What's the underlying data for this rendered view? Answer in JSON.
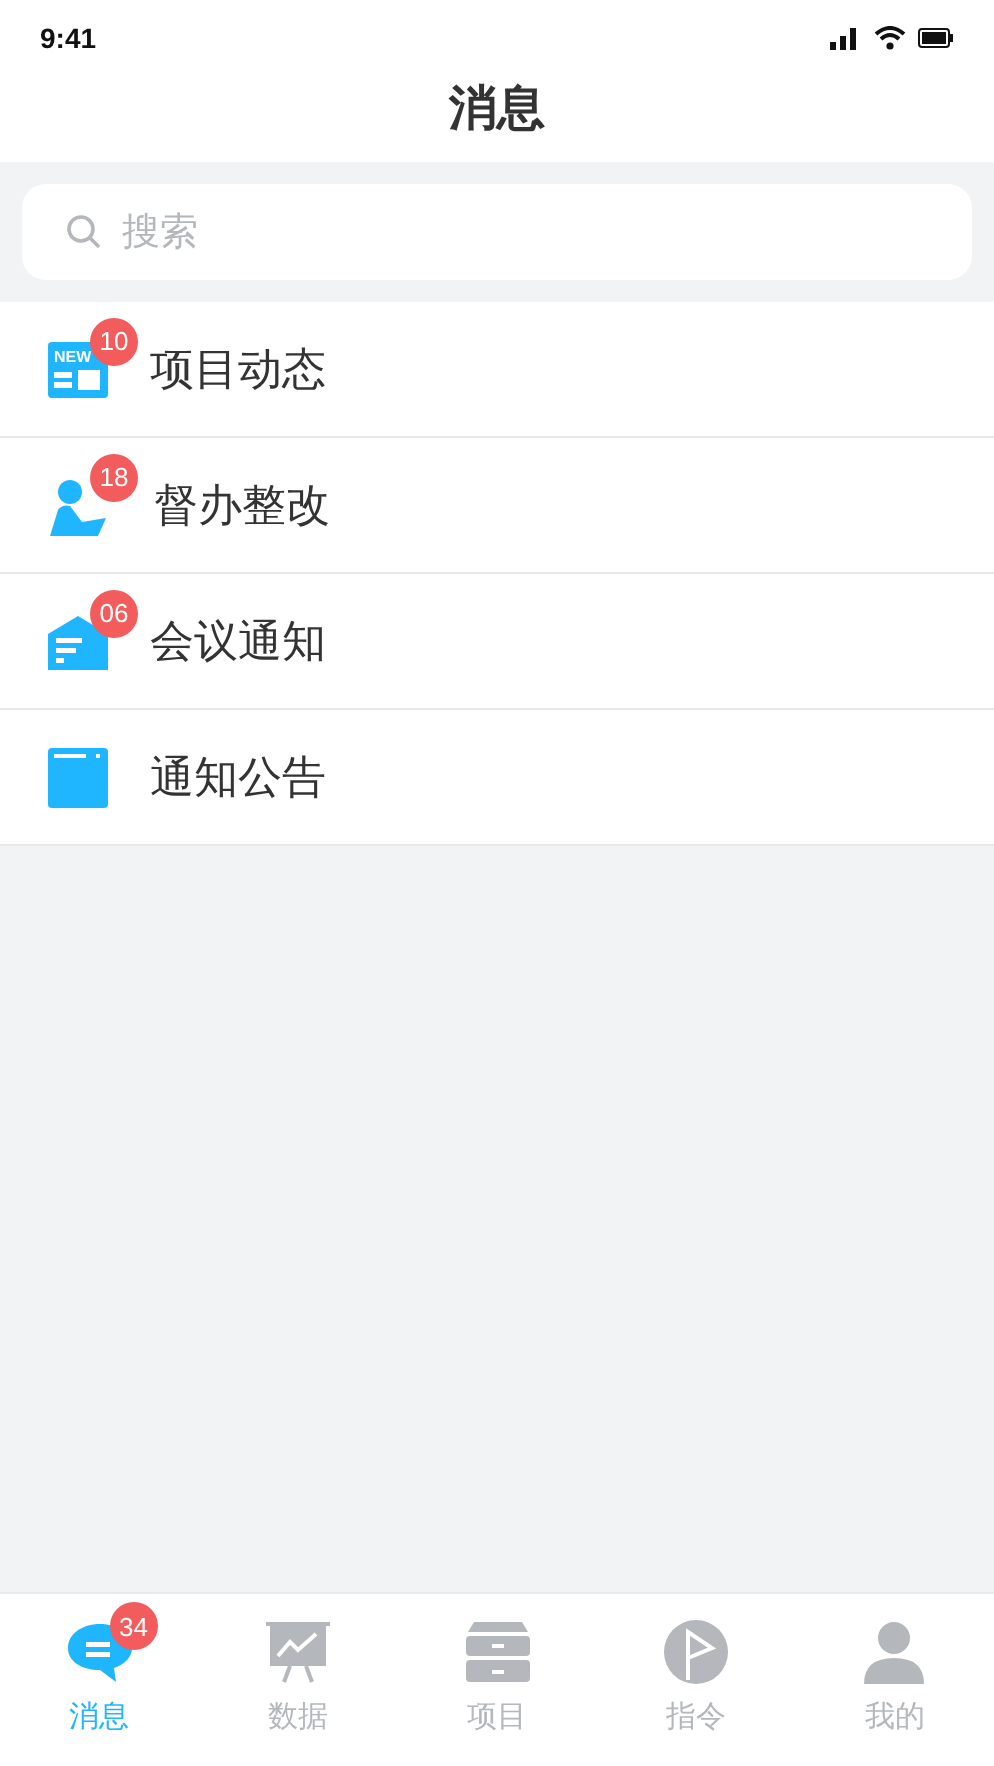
{
  "status_bar": {
    "time": "9:41"
  },
  "header": {
    "title": "消息"
  },
  "search": {
    "placeholder": "搜索"
  },
  "items": [
    {
      "kind": "news",
      "icon_text": "NEW",
      "label": "项目动态",
      "badge": "10"
    },
    {
      "kind": "person",
      "label": "督办整改",
      "badge": "18"
    },
    {
      "kind": "meeting",
      "label": "会议通知",
      "badge": "06"
    },
    {
      "kind": "notice",
      "label": "通知公告"
    }
  ],
  "tabs": [
    {
      "kind": "chat",
      "label": "消息",
      "badge": "34",
      "selected": true
    },
    {
      "kind": "chart",
      "label": "数据",
      "selected": false
    },
    {
      "kind": "cabinet",
      "label": "项目",
      "selected": false
    },
    {
      "kind": "flag",
      "label": "指令",
      "selected": false
    },
    {
      "kind": "user",
      "label": "我的",
      "selected": false
    }
  ]
}
